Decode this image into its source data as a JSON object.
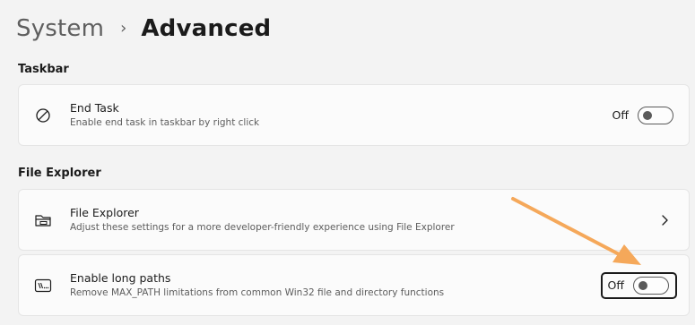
{
  "breadcrumb": {
    "parent": "System",
    "separator": "›",
    "current": "Advanced"
  },
  "sections": [
    {
      "header": "Taskbar",
      "cards": [
        {
          "icon": "block-icon",
          "title": "End Task",
          "description": "Enable end task in taskbar by right click",
          "toggle": {
            "label": "Off",
            "on": false
          }
        }
      ]
    },
    {
      "header": "File Explorer",
      "cards": [
        {
          "icon": "folder-icon",
          "title": "File Explorer",
          "description": "Adjust these settings for a more developer-friendly experience using File Explorer",
          "chevron": "chevron-right-icon"
        },
        {
          "icon": "terminal-path-icon",
          "title": "Enable long paths",
          "description": "Remove MAX_PATH limitations from common Win32 file and directory functions",
          "toggle": {
            "label": "Off",
            "on": false,
            "focused": true
          }
        }
      ]
    }
  ],
  "colors": {
    "background": "#f3f3f3",
    "card": "#fbfbfb",
    "annotation_arrow": "#f5a85a"
  }
}
